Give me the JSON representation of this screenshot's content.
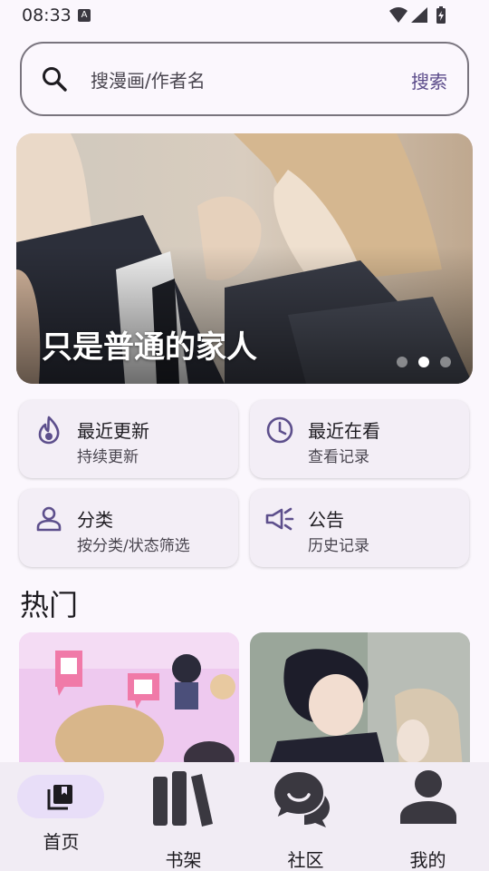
{
  "status": {
    "time": "08:33",
    "badge": "A"
  },
  "search": {
    "placeholder": "搜漫画/作者名",
    "button_label": "搜索"
  },
  "banner": {
    "title": "只是普通的家人",
    "active_dot": 2,
    "dot_count": 3
  },
  "quick_links": [
    {
      "title": "最近更新",
      "subtitle": "持续更新",
      "icon": "flame-icon"
    },
    {
      "title": "最近在看",
      "subtitle": "查看记录",
      "icon": "clock-icon"
    },
    {
      "title": "分类",
      "subtitle": "按分类/状态筛选",
      "icon": "person-icon"
    },
    {
      "title": "公告",
      "subtitle": "历史记录",
      "icon": "megaphone-icon"
    }
  ],
  "section": {
    "title": "热门"
  },
  "nav": {
    "items": [
      {
        "label": "首页",
        "icon": "library-icon",
        "active": true
      },
      {
        "label": "书架",
        "icon": "bookshelf-icon",
        "active": false
      },
      {
        "label": "社区",
        "icon": "chat-icon",
        "active": false
      },
      {
        "label": "我的",
        "icon": "account-icon",
        "active": false
      }
    ]
  },
  "colors": {
    "accent": "#5b4b8a",
    "icon": "#5d4f8c",
    "card_bg": "#f3eef6",
    "nav_pill": "#e8def8"
  }
}
